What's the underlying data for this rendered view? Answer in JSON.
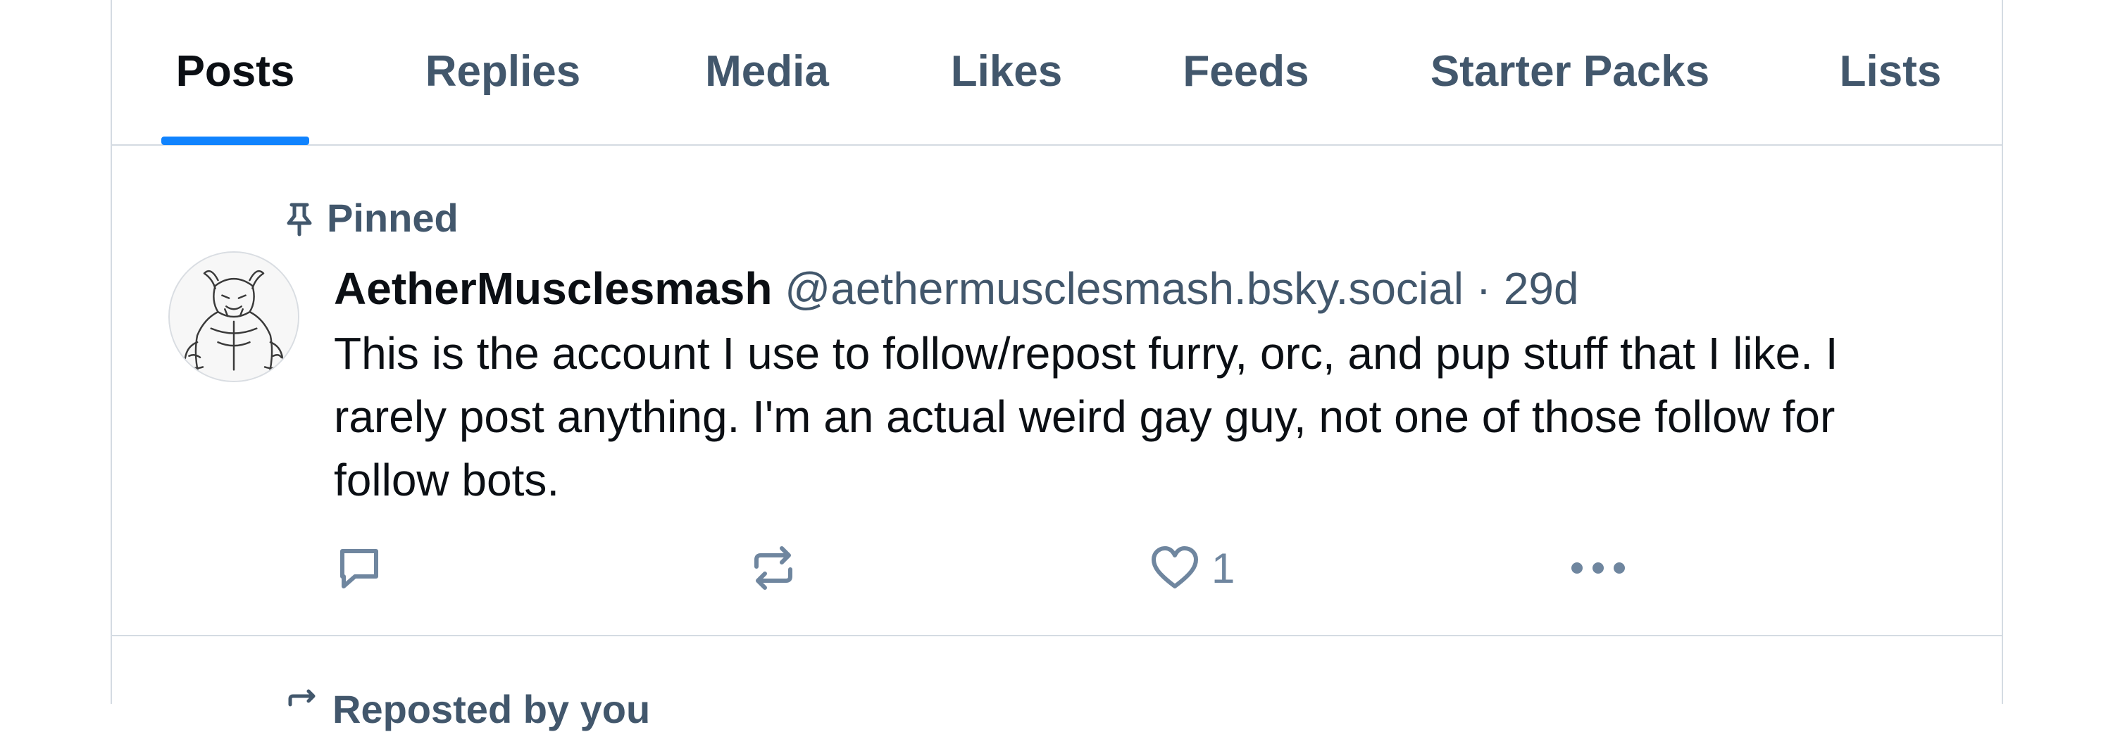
{
  "tabs": [
    {
      "label": "Posts",
      "active": true
    },
    {
      "label": "Replies",
      "active": false
    },
    {
      "label": "Media",
      "active": false
    },
    {
      "label": "Likes",
      "active": false
    },
    {
      "label": "Feeds",
      "active": false
    },
    {
      "label": "Starter Packs",
      "active": false
    },
    {
      "label": "Lists",
      "active": false
    }
  ],
  "post": {
    "pinned_label": "Pinned",
    "author": {
      "display_name": "AetherMusclesmash",
      "handle": "@aethermusclesmash.bsky.social"
    },
    "separator": "·",
    "time": "29d",
    "text": "This is the account I use to follow/repost furry, orc, and pup stuff that I like. I rarely post anything. I'm an actual weird gay guy, not one of those follow for follow bots.",
    "actions": {
      "reply_icon": "reply-bubble-icon",
      "repost_icon": "repost-icon",
      "like_icon": "heart-icon",
      "like_count": "1",
      "more_icon": "more-dots-icon"
    }
  },
  "next_post": {
    "label": "Reposted by you",
    "icon": "repost-icon"
  },
  "colors": {
    "accent": "#1083fe",
    "muted_text": "#42576c",
    "action_icons": "#6f869f",
    "border": "#d4dbe2"
  }
}
